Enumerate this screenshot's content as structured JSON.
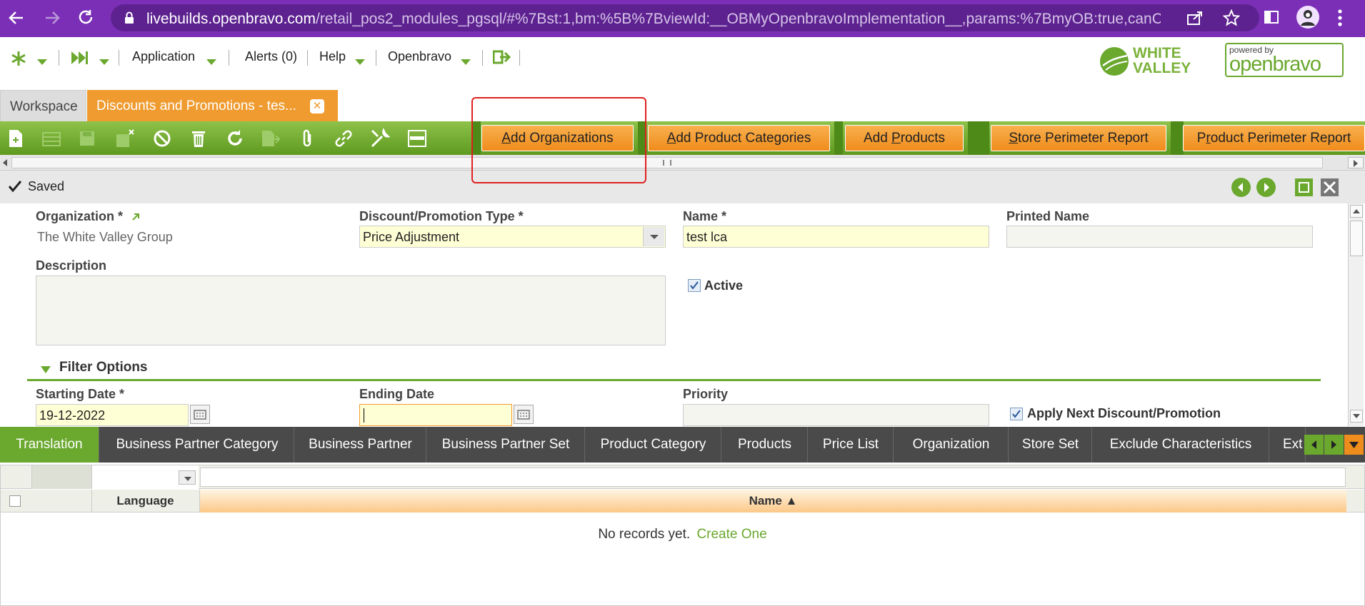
{
  "browser": {
    "url_host": "livebuilds.openbravo.com",
    "url_path": "/retail_pos2_modules_pgsql/#%7Bst:1,bm:%5B%7BviewId:__OBMyOpenbravoImplementation__,params:%7BmyOB:true,canClose:..."
  },
  "topmenu": {
    "application": "Application",
    "alerts": "Alerts (0)",
    "help": "Help",
    "user": "Openbravo",
    "brand_line1": "WHITE",
    "brand_line2": "VALLEY",
    "powered_by": "powered by",
    "openbravo_logo": "openbravo"
  },
  "tabs": {
    "workspace": "Workspace",
    "active": "Discounts and Promotions - tes..."
  },
  "toolbar": {
    "buttons": [
      "Add Organizations",
      "Add Product Categories",
      "Add Products",
      "Store Perimeter Report",
      "Product Perimeter Report"
    ],
    "underline": [
      "A",
      "A",
      "P",
      "S",
      "r"
    ]
  },
  "status": {
    "text": "Saved"
  },
  "form": {
    "organization_label": "Organization *",
    "organization_value": "The White Valley Group",
    "type_label": "Discount/Promotion Type *",
    "type_value": "Price Adjustment",
    "name_label": "Name *",
    "name_value": "test lca",
    "printed_name_label": "Printed Name",
    "printed_name_value": "",
    "description_label": "Description",
    "description_value": "",
    "active_label": "Active",
    "active_checked": true,
    "section_filter": "Filter Options",
    "starting_date_label": "Starting Date *",
    "starting_date_value": "19-12-2022",
    "ending_date_label": "Ending Date",
    "ending_date_value": "",
    "priority_label": "Priority",
    "priority_value": "",
    "apply_next_label": "Apply Next Discount/Promotion",
    "apply_next_checked": true
  },
  "subtabs": [
    "Translation",
    "Business Partner Category",
    "Business Partner",
    "Business Partner Set",
    "Product Category",
    "Products",
    "Price List",
    "Organization",
    "Store Set",
    "Exclude Characteristics",
    "Ext"
  ],
  "grid": {
    "col_language": "Language",
    "col_name": "Name ▲",
    "empty_text": "No records yet.",
    "create_link": "Create One"
  },
  "colors": {
    "browser_chrome": "#7b2fb7",
    "toolbar_green": "#6aa82e",
    "orange_button": "#f29a2e",
    "subtab_active": "#6aa82e"
  }
}
